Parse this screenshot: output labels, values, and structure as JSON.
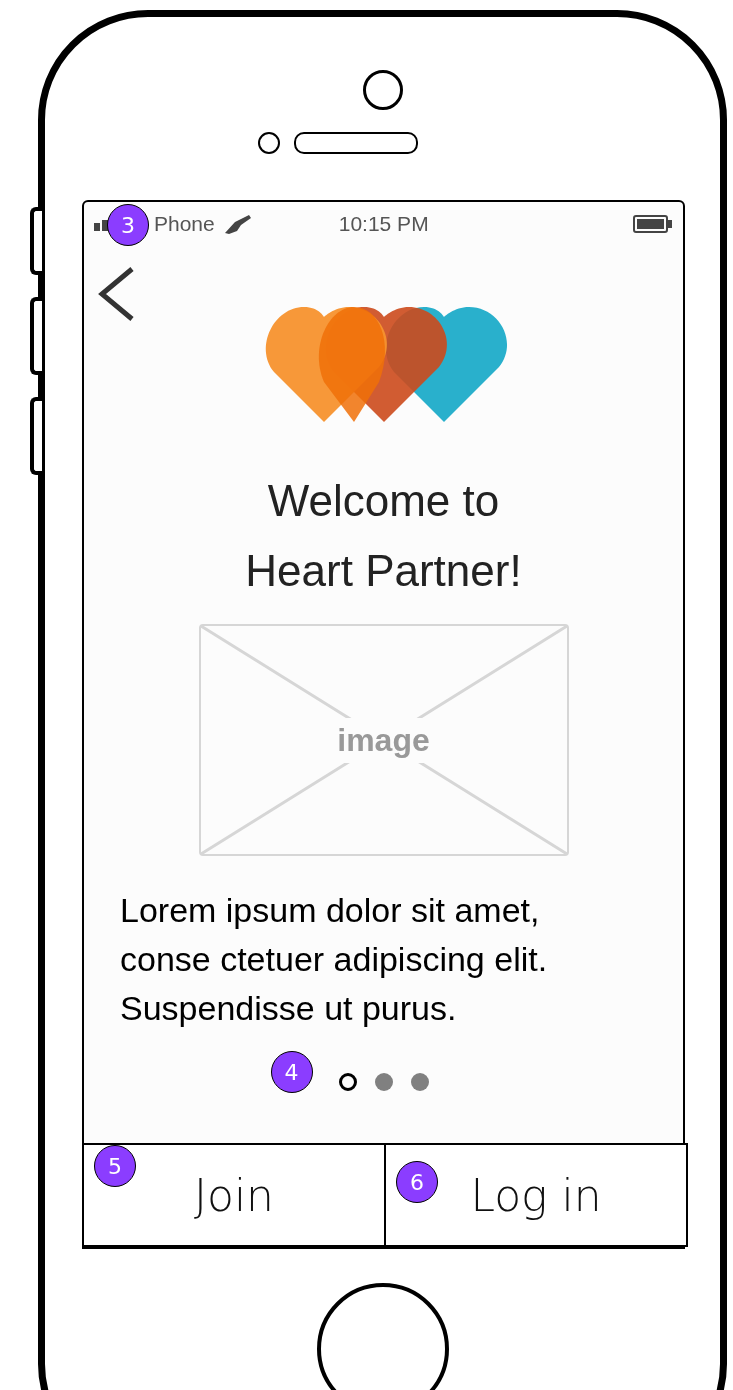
{
  "status_bar": {
    "carrier": "Phone",
    "time": "10:15 PM"
  },
  "title_lines": [
    "Welcome to",
    "Heart Partner!"
  ],
  "image_placeholder": {
    "label": "image"
  },
  "body_text": "Lorem ipsum dolor sit amet, conse ctetuer adipiscing elit. Suspendisse ut purus.",
  "page_dots": [
    {
      "selected": true
    },
    {
      "selected": false
    },
    {
      "selected": false
    }
  ],
  "buttons": [
    {
      "label": "Join",
      "badge": "5"
    },
    {
      "label": "Log in",
      "badge": "6"
    }
  ],
  "badges": {
    "status": "3",
    "dots": "4"
  }
}
